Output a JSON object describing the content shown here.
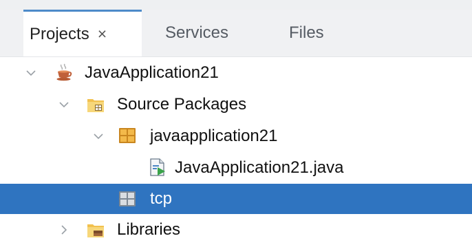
{
  "tabs": [
    {
      "label": "Projects",
      "close": "×",
      "active": true
    },
    {
      "label": "Services",
      "active": false
    },
    {
      "label": "Files",
      "active": false
    }
  ],
  "tree": {
    "project": {
      "label": "JavaApplication21",
      "expanded": true,
      "icon": "java-project-icon"
    },
    "source_packages": {
      "label": "Source Packages",
      "expanded": true,
      "icon": "source-packages-folder-icon"
    },
    "package": {
      "label": "javaapplication21",
      "expanded": true,
      "icon": "package-icon"
    },
    "file": {
      "label": "JavaApplication21.java",
      "icon": "java-file-icon"
    },
    "tcp": {
      "label": "tcp",
      "selected": true,
      "icon": "empty-package-icon"
    },
    "libraries": {
      "label": "Libraries",
      "expanded": false,
      "icon": "libraries-folder-icon"
    }
  },
  "colors": {
    "selection": "#2f74c0",
    "tab_accent": "#4d8ac9",
    "package_orange": "#e5a93b"
  }
}
